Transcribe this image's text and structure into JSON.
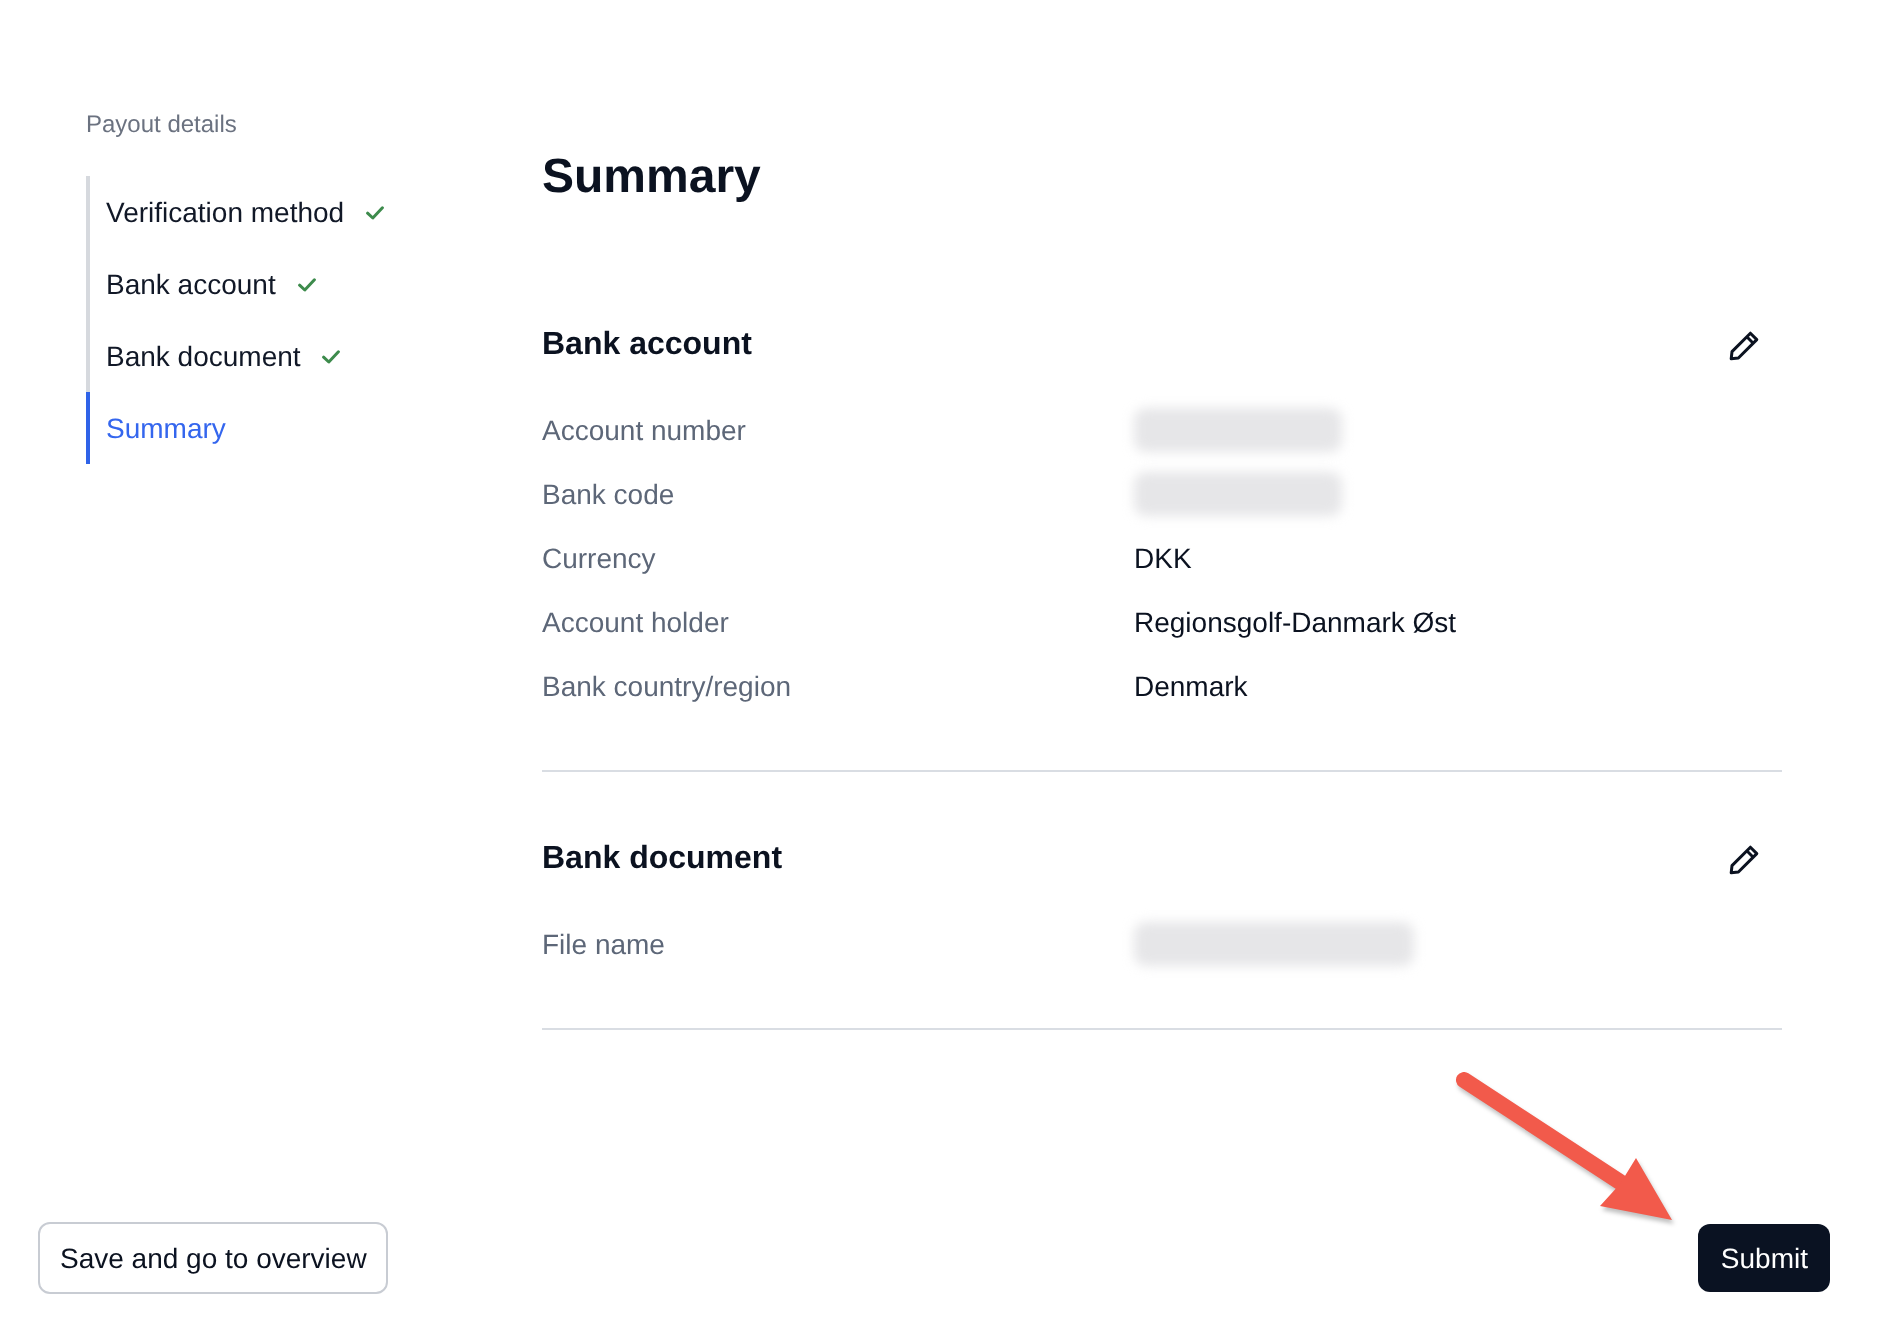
{
  "sidebar": {
    "title": "Payout details",
    "items": [
      {
        "label": "Verification method",
        "completed": true,
        "selected": false
      },
      {
        "label": "Bank account",
        "completed": true,
        "selected": false
      },
      {
        "label": "Bank document",
        "completed": true,
        "selected": false
      },
      {
        "label": "Summary",
        "completed": false,
        "selected": true
      }
    ]
  },
  "main": {
    "title": "Summary",
    "sections": [
      {
        "title": "Bank account",
        "editable": true,
        "rows": [
          {
            "label": "Account number",
            "redacted": true
          },
          {
            "label": "Bank code",
            "redacted": true
          },
          {
            "label": "Currency",
            "value": "DKK",
            "redacted": false
          },
          {
            "label": "Account holder",
            "value": "Regionsgolf-Danmark Øst",
            "redacted": false
          },
          {
            "label": "Bank country/region",
            "value": "Denmark",
            "redacted": false
          }
        ]
      },
      {
        "title": "Bank document",
        "editable": true,
        "rows": [
          {
            "label": "File name",
            "redacted": true
          }
        ]
      }
    ]
  },
  "footer": {
    "buttons": [
      {
        "label": "Save and go to overview",
        "kind": "secondary"
      },
      {
        "label": "Submit",
        "kind": "primary"
      }
    ]
  },
  "annotations": [
    {
      "kind": "arrow"
    }
  ]
}
